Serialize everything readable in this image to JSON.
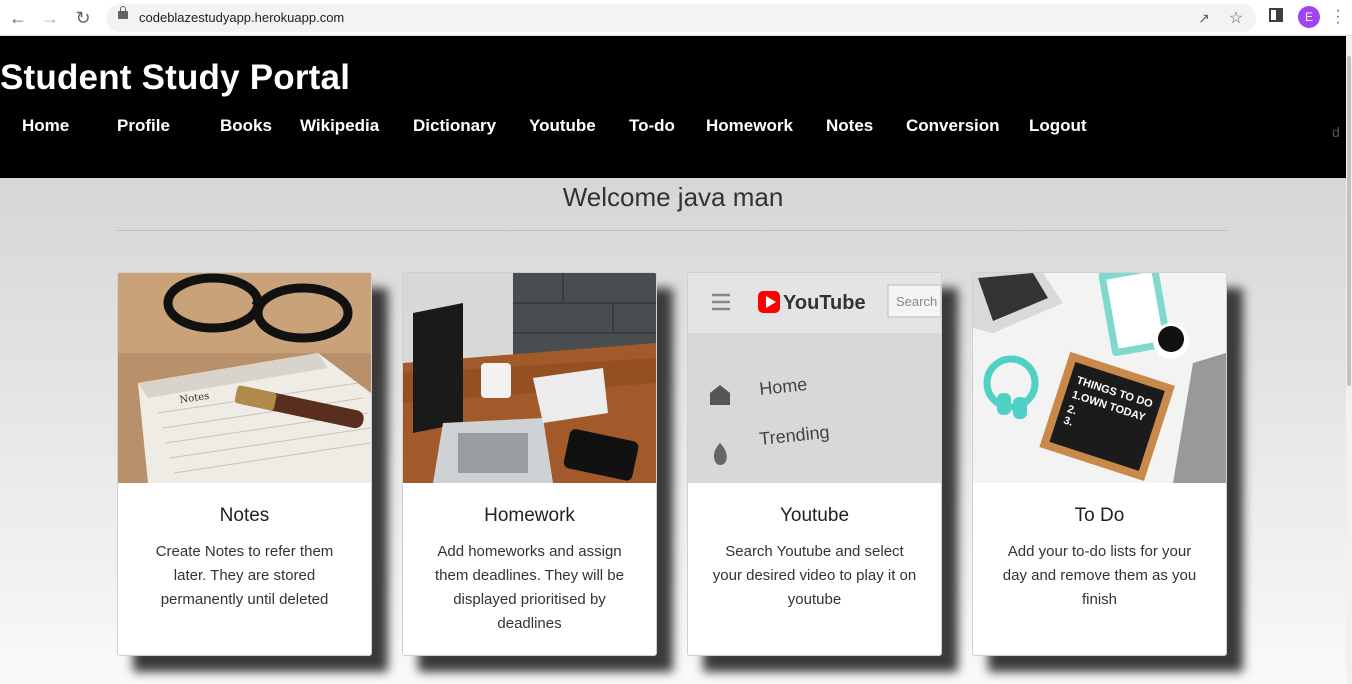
{
  "browser": {
    "url": "codeblazestudyapp.herokuapp.com",
    "profile_initial": "E"
  },
  "site": {
    "brand": "Student Study Portal",
    "nav": [
      "Home",
      "Profile",
      "Books",
      "Wikipedia",
      "Dictionary",
      "Youtube",
      "To-do",
      "Homework",
      "Notes",
      "Conversion",
      "Logout"
    ],
    "ghost_text": "d"
  },
  "main": {
    "welcome": "Welcome java man",
    "cards": [
      {
        "title": "Notes",
        "text": "Create Notes to refer them later. They are stored permanently until deleted",
        "image": "notebook-pen-glasses"
      },
      {
        "title": "Homework",
        "text": "Add homeworks and assign them deadlines. They will be displayed prioritised by deadlines",
        "image": "laptop-desk-coffee"
      },
      {
        "title": "Youtube",
        "text": "Search Youtube and select your desired video to play it on youtube",
        "image": "youtube-screen"
      },
      {
        "title": "To Do",
        "text": "Add your to-do lists for your day and remove them as you finish",
        "image": "todo-letterboard-desk"
      }
    ]
  },
  "colors": {
    "header_bg": "#000000",
    "youtube_red": "#ff0000",
    "avatar": "#a142f4"
  }
}
